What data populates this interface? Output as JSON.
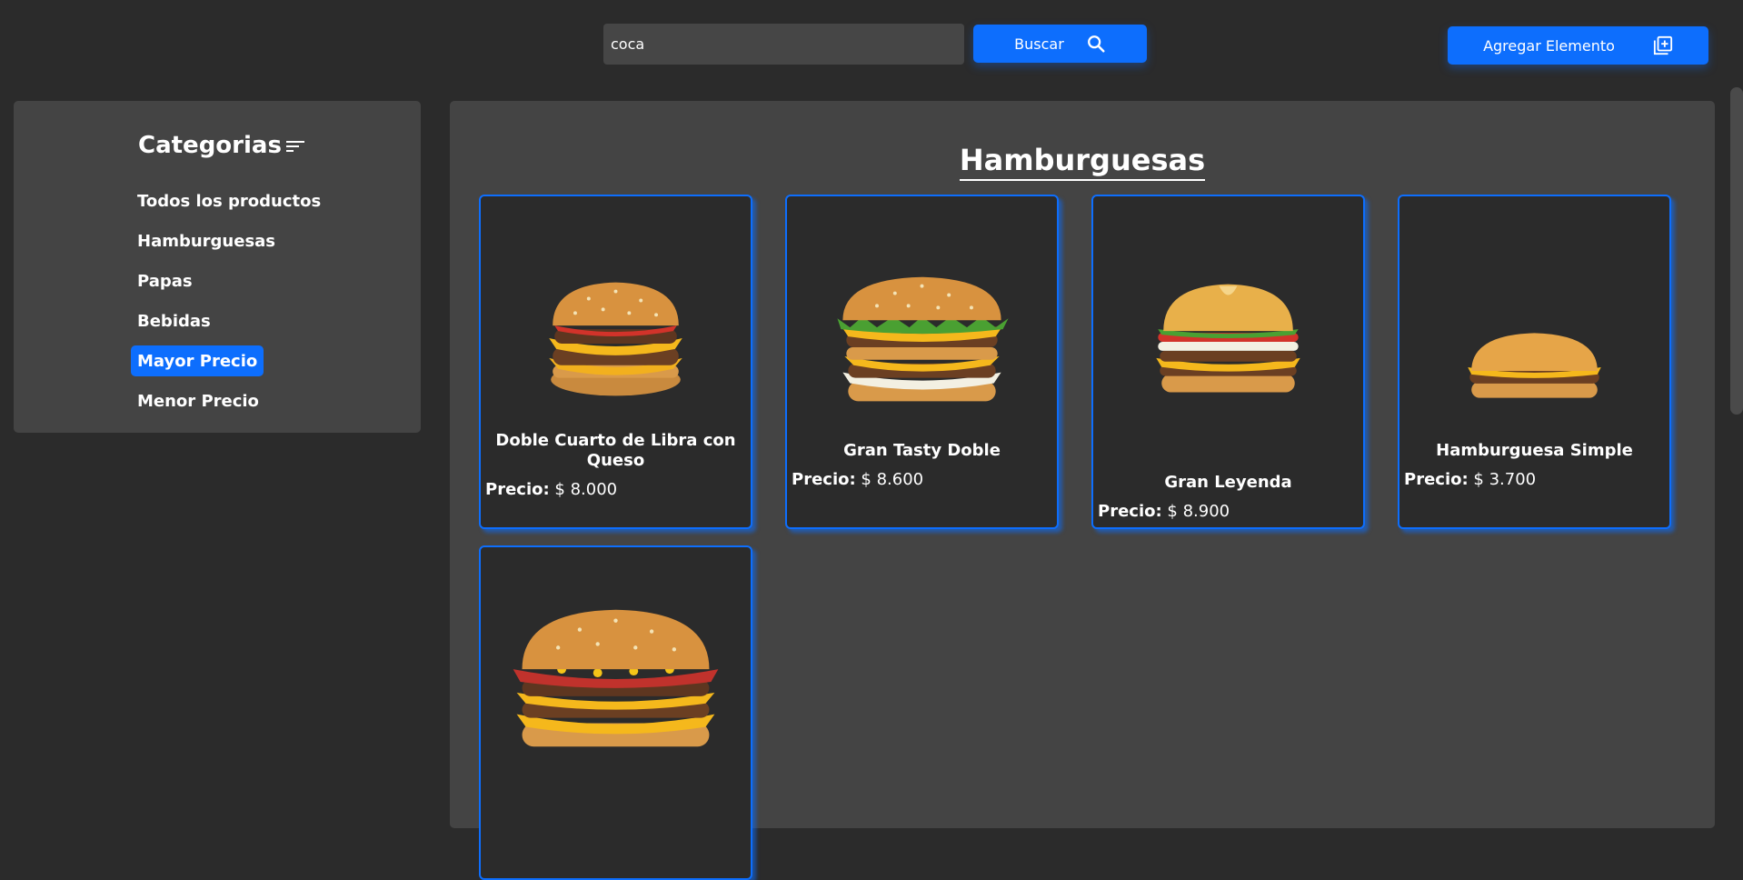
{
  "search": {
    "value": "coca",
    "button_label": "Buscar"
  },
  "add_button_label": "Agregar Elemento",
  "sidebar": {
    "title": "Categorias",
    "items": [
      {
        "label": "Todos los productos",
        "active": false
      },
      {
        "label": "Hamburguesas",
        "active": false
      },
      {
        "label": "Papas",
        "active": false
      },
      {
        "label": "Bebidas",
        "active": false
      },
      {
        "label": "Mayor Precio",
        "active": true
      },
      {
        "label": "Menor Precio",
        "active": false
      }
    ]
  },
  "main": {
    "title": "Hamburguesas",
    "price_label": "Precio:",
    "products": [
      {
        "name": "Doble Cuarto de Libra con Queso",
        "price": "$ 8.000"
      },
      {
        "name": "Gran Tasty Doble",
        "price": "$ 8.600"
      },
      {
        "name": "Gran Leyenda",
        "price": "$ 8.900"
      },
      {
        "name": "Hamburguesa Simple",
        "price": "$ 3.700"
      },
      {
        "name": "",
        "price": ""
      }
    ]
  },
  "colors": {
    "accent": "#0d6efd",
    "background": "#2b2b2b",
    "panel": "#444444"
  }
}
